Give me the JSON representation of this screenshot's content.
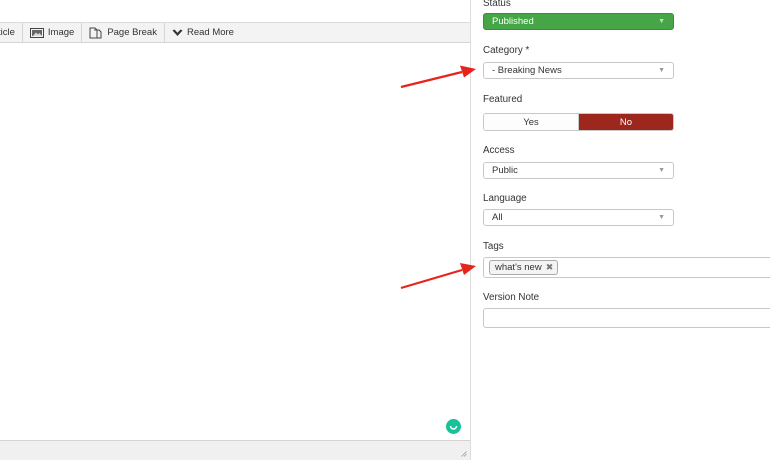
{
  "toolbar": {
    "buttons": [
      {
        "label": "ticle",
        "icon": "article-icon"
      },
      {
        "label": "Image",
        "icon": "image-icon"
      },
      {
        "label": "Page Break",
        "icon": "page-break-icon"
      },
      {
        "label": "Read More",
        "icon": "chevron-down-icon"
      }
    ]
  },
  "panel": {
    "status": {
      "label": "Status",
      "value": "Published"
    },
    "category": {
      "label": "Category *",
      "value": "- Breaking News"
    },
    "featured": {
      "label": "Featured",
      "yes": "Yes",
      "no": "No",
      "selected": "No"
    },
    "access": {
      "label": "Access",
      "value": "Public"
    },
    "language": {
      "label": "Language",
      "value": "All"
    },
    "tags": {
      "label": "Tags",
      "chips": [
        "what's new"
      ],
      "remove_glyph": "✖"
    },
    "version_note": {
      "label": "Version Note",
      "value": ""
    }
  },
  "colors": {
    "status_green": "#46a546",
    "featured_no_red": "#9d261d",
    "annotation_arrow": "#e8231b",
    "grammar_badge": "#15c39a"
  },
  "select_caret": "▼"
}
